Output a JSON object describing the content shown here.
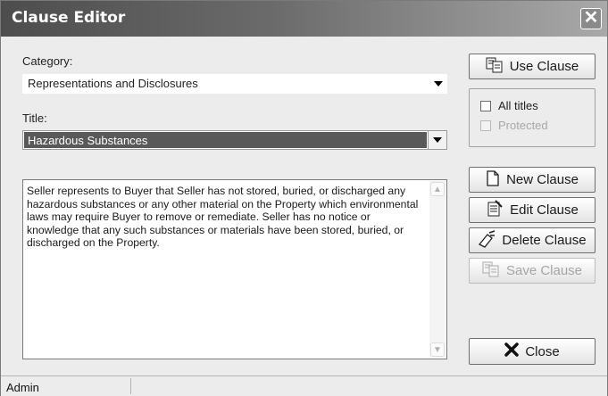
{
  "window": {
    "title": "Clause Editor",
    "close_glyph": "✕"
  },
  "category": {
    "label": "Category:",
    "value": "Representations and Disclosures"
  },
  "title_field": {
    "label": "Title:",
    "value": "Hazardous Substances"
  },
  "clause_text": "Seller represents to Buyer that Seller has not stored, buried, or discharged any hazardous substances or any other material on the Property which environmental laws may require Buyer to remove or remediate.  Seller has no notice or knowledge that any such substances or materials have been stored, buried, or discharged on the Property.",
  "buttons": {
    "use_clause": "Use Clause",
    "new_clause": "New Clause",
    "edit_clause": "Edit Clause",
    "delete_clause": "Delete Clause",
    "save_clause": "Save Clause",
    "close": "Close"
  },
  "options": {
    "all_titles": {
      "label": "All titles",
      "checked": false
    },
    "protected": {
      "label": "Protected",
      "checked": false,
      "enabled": false
    }
  },
  "status": {
    "user": "Admin"
  },
  "icons": {
    "use_clause": "document-copy-icon",
    "new_clause": "new-document-icon",
    "edit_clause": "edit-document-icon",
    "delete_clause": "delete-eraser-icon",
    "save_clause": "save-document-icon",
    "close": "x-close-icon"
  }
}
